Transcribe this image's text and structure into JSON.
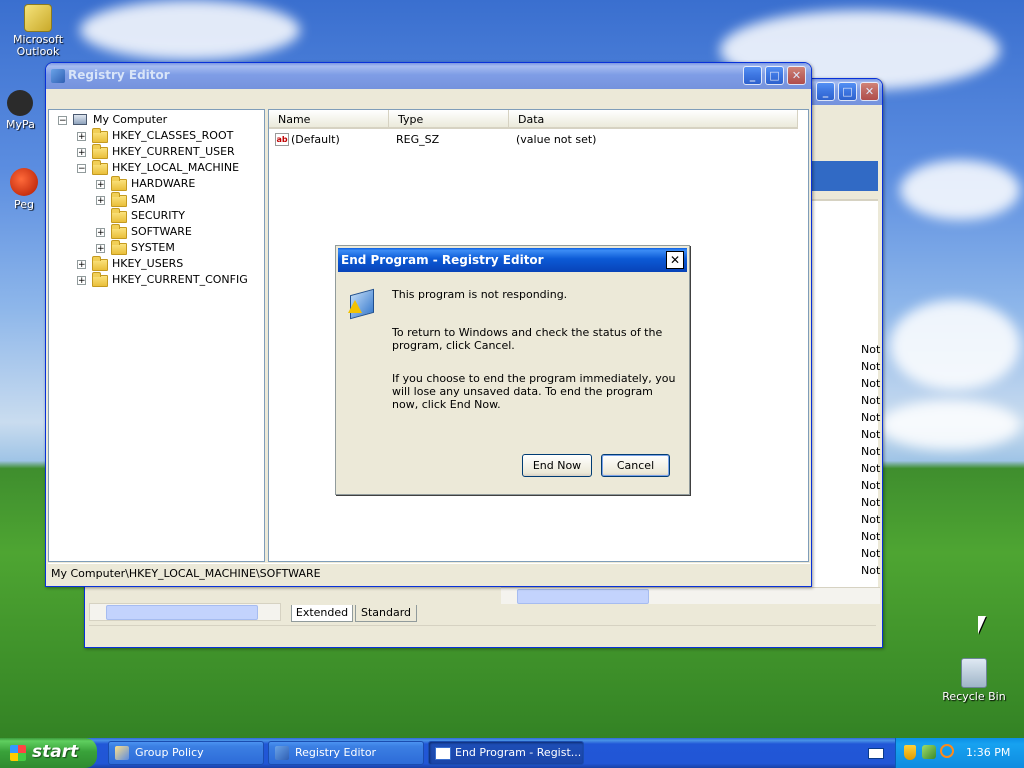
{
  "desktop": {
    "icons": [
      {
        "label": "Microsoft Outlook",
        "icon": "outlook-icon"
      },
      {
        "label": "MyPa",
        "icon": "folder-shortcut-icon"
      },
      {
        "label": "Peg",
        "icon": "app-shortcut-icon"
      },
      {
        "label": "Recycle Bin",
        "icon": "recycle-bin-icon"
      }
    ]
  },
  "background_window": {
    "tabs": [
      "Extended",
      "Standard"
    ],
    "right_column_values": [
      "Not",
      "Not",
      "Not",
      "Not",
      "Not",
      "Not",
      "Not",
      "Not",
      "Not",
      "Not",
      "Not",
      "Not",
      "Not",
      "Not"
    ]
  },
  "registry": {
    "title": "Registry Editor",
    "tree": [
      {
        "label": "My Computer",
        "level": 0,
        "expander": "-"
      },
      {
        "label": "HKEY_CLASSES_ROOT",
        "level": 1,
        "expander": "+"
      },
      {
        "label": "HKEY_CURRENT_USER",
        "level": 1,
        "expander": "+"
      },
      {
        "label": "HKEY_LOCAL_MACHINE",
        "level": 1,
        "expander": "-"
      },
      {
        "label": "HARDWARE",
        "level": 2,
        "expander": "+"
      },
      {
        "label": "SAM",
        "level": 2,
        "expander": "+"
      },
      {
        "label": "SECURITY",
        "level": 2,
        "expander": ""
      },
      {
        "label": "SOFTWARE",
        "level": 2,
        "expander": "+"
      },
      {
        "label": "SYSTEM",
        "level": 2,
        "expander": "+"
      },
      {
        "label": "HKEY_USERS",
        "level": 1,
        "expander": "+"
      },
      {
        "label": "HKEY_CURRENT_CONFIG",
        "level": 1,
        "expander": "+"
      }
    ],
    "columns": [
      "Name",
      "Type",
      "Data"
    ],
    "values": [
      {
        "name": "(Default)",
        "type": "REG_SZ",
        "data": "(value not set)"
      }
    ],
    "status": "My Computer\\HKEY_LOCAL_MACHINE\\SOFTWARE"
  },
  "dialog": {
    "title": "End Program - Registry Editor",
    "line1": "This program is not responding.",
    "line2": "To return to Windows and check the status of the program, click Cancel.",
    "line3": "If you choose to end the program immediately, you will lose any unsaved data. To end the program now, click End Now.",
    "end_now": "End Now",
    "cancel": "Cancel"
  },
  "taskbar": {
    "start": "start",
    "tasks": [
      "Group Policy",
      "Registry Editor",
      "End Program - Regist..."
    ],
    "clock": "1:36 PM"
  }
}
